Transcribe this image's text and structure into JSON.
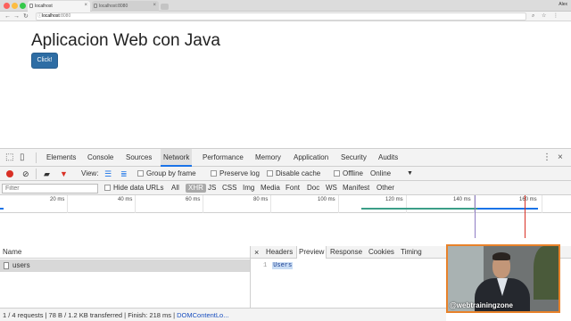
{
  "browser": {
    "tabs": [
      {
        "label": "localhost",
        "active": true
      },
      {
        "label": "localhost:8080",
        "active": false
      }
    ],
    "profile_name": "Alex",
    "address": {
      "host": "localhost",
      "port": ":8080"
    }
  },
  "page": {
    "title": "Aplicacion Web con Java",
    "button_label": "Click!",
    "button_color": "#2e6da4"
  },
  "devtools": {
    "tabs": [
      "Elements",
      "Console",
      "Sources",
      "Network",
      "Performance",
      "Memory",
      "Application",
      "Security",
      "Audits"
    ],
    "active_tab": "Network",
    "toolbar": {
      "view_label": "View:",
      "group_by_frame": "Group by frame",
      "preserve_log": "Preserve log",
      "disable_cache": "Disable cache",
      "offline": "Offline",
      "throttle": "Online"
    },
    "filter": {
      "placeholder": "Filter",
      "hide_data_urls": "Hide data URLs",
      "types": [
        "All",
        "XHR",
        "JS",
        "CSS",
        "Img",
        "Media",
        "Font",
        "Doc",
        "WS",
        "Manifest",
        "Other"
      ],
      "active_type": "XHR"
    },
    "timeline_ticks": [
      "20 ms",
      "40 ms",
      "60 ms",
      "80 ms",
      "100 ms",
      "120 ms",
      "140 ms",
      "160 ms"
    ],
    "requests": {
      "column_name": "Name",
      "rows": [
        {
          "name": "users"
        }
      ]
    },
    "detail": {
      "tabs": [
        "Headers",
        "Preview",
        "Response",
        "Cookies",
        "Timing"
      ],
      "active_tab": "Preview",
      "preview": {
        "line_number": "1",
        "value": "Users"
      }
    },
    "status": {
      "summary": "1 / 4 requests | 78 B / 1.2 KB transferred | Finish: 218 ms |",
      "dom_loaded": "DOMContentLo..."
    }
  },
  "webcam": {
    "handle": "@webtrainingzone",
    "border_color": "#e8822a"
  }
}
